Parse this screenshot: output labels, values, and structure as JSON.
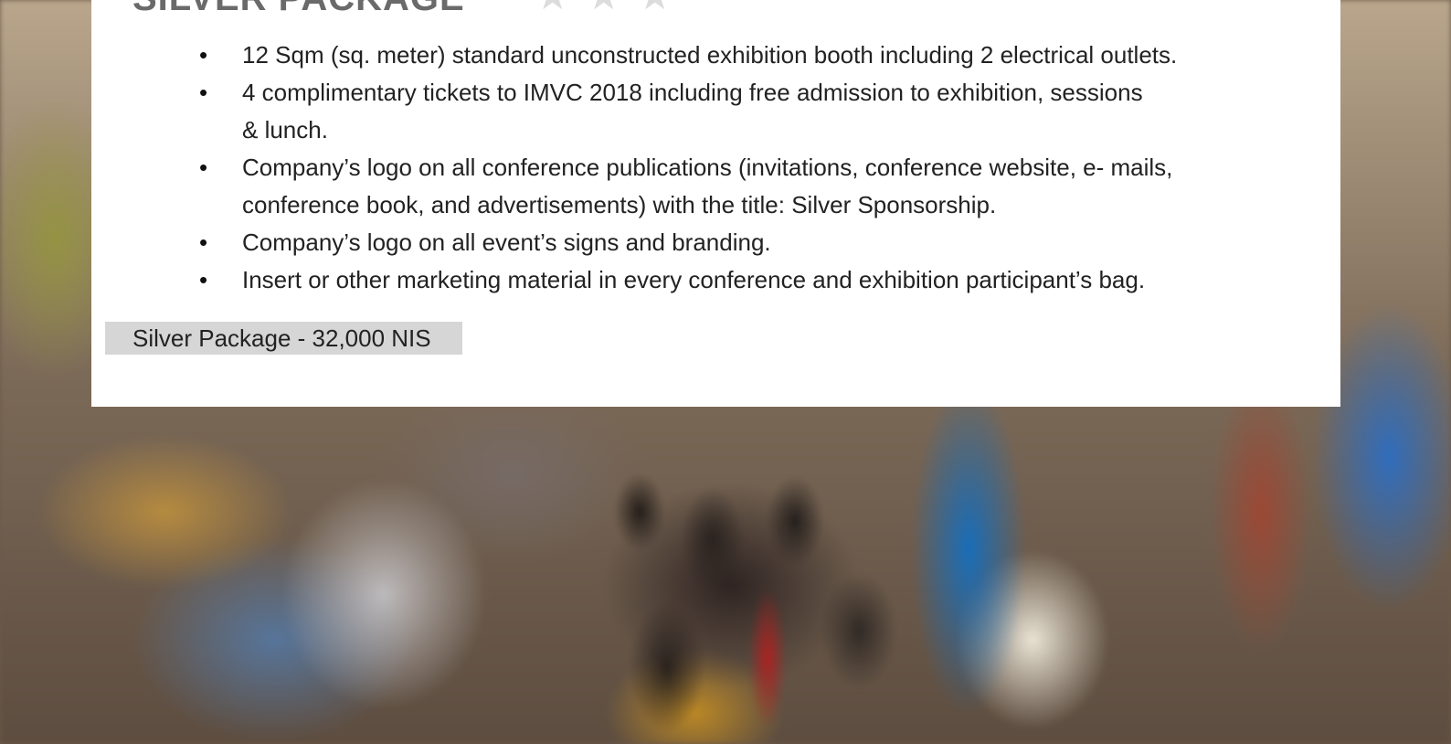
{
  "package": {
    "title": "SILVER PACKAGE",
    "stars": 3,
    "features": [
      "12 Sqm (sq. meter) standard unconstructed exhibition booth including 2 electrical outlets.",
      "4 complimentary tickets to IMVC 2018 including free admission to exhibition, sessions & lunch.",
      "Company’s logo on all conference publications (invitations, conference website, e- mails, conference book, and advertisements) with the title: Silver Sponsorship.",
      "Company’s logo on all event’s signs and branding.",
      "Insert or other marketing material in every conference and exhibition participant’s bag."
    ],
    "price_label": "Silver Package - 32,000 NIS"
  },
  "colors": {
    "card_background": "#ffffff",
    "heading": "#6a6a6a",
    "star": "#dcdcdc",
    "price_background": "#d6d6d6"
  },
  "icons": {
    "star": "star-icon"
  }
}
